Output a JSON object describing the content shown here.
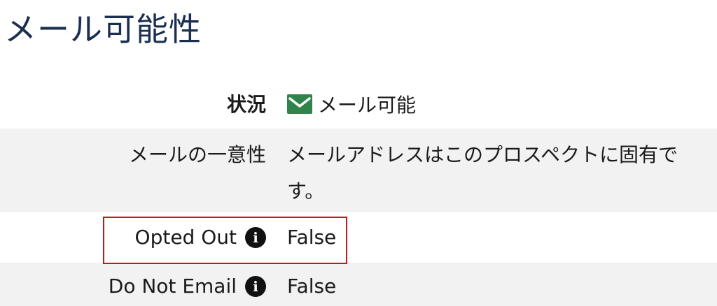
{
  "title": "メール可能性",
  "rows": {
    "status": {
      "label": "状況",
      "value": "メール可能",
      "icon": "mail-check-icon",
      "icon_color": "#2e844a"
    },
    "uniqueness": {
      "label": "メールの一意性",
      "value": "メールアドレスはこのプロスペクトに固有です。"
    },
    "opted_out": {
      "label": "Opted Out",
      "value": "False",
      "icon": "info-icon"
    },
    "do_not_email": {
      "label": "Do Not Email",
      "value": "False",
      "icon": "info-icon"
    }
  },
  "highlight_color": "#c8161e"
}
